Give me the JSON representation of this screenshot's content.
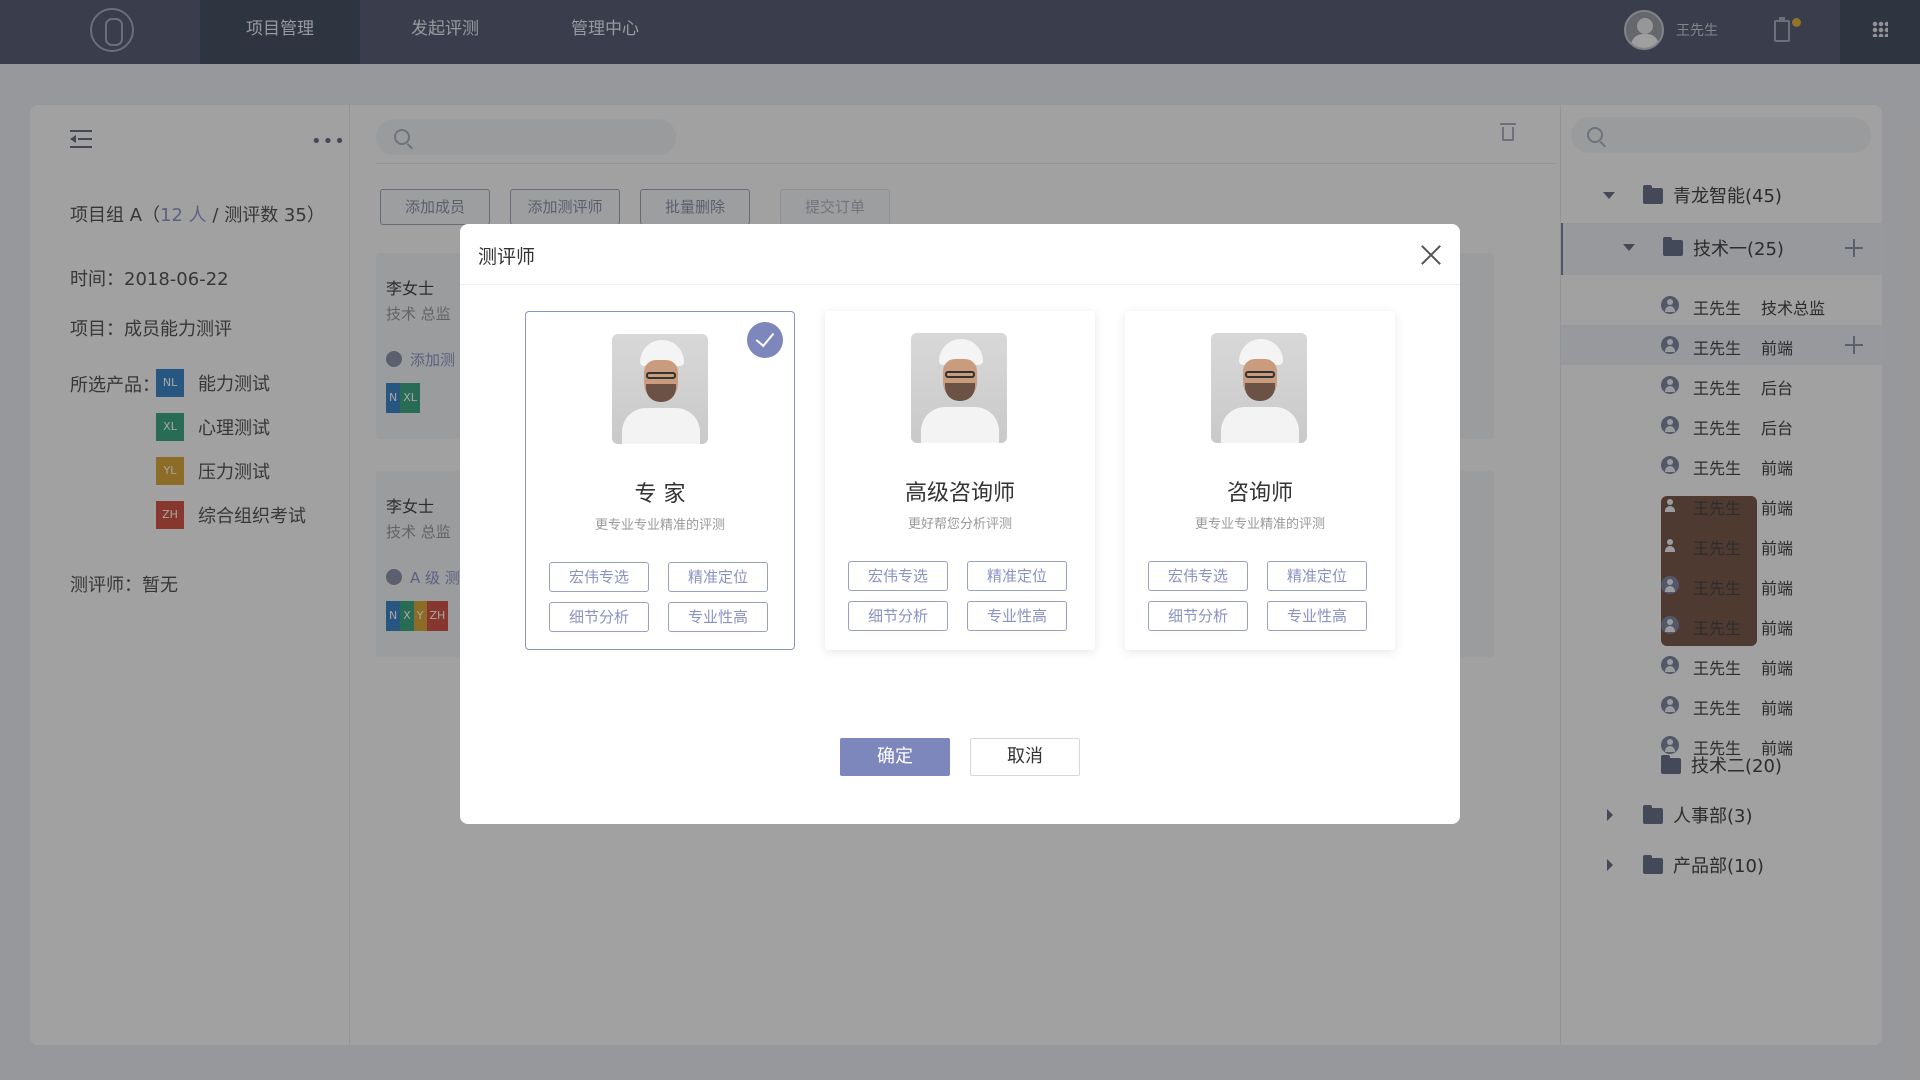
{
  "header": {
    "nav": [
      "项目管理",
      "发起评测",
      "管理中心"
    ],
    "user_name": "王先生"
  },
  "left_panel": {
    "group_prefix": "项目组 A（",
    "group_members": "12 人",
    "group_suffix": " / 测评数 35）",
    "time": "时间：2018-06-22",
    "project": "项目：成员能力测评",
    "products_label": "所选产品：",
    "products": [
      {
        "code": "NL",
        "name": "能力测试",
        "color": "#3d86c6"
      },
      {
        "code": "XL",
        "name": "心理测试",
        "color": "#3ea684"
      },
      {
        "code": "YL",
        "name": "压力测试",
        "color": "#d7a73b"
      },
      {
        "code": "ZH",
        "name": "综合组织考试",
        "color": "#d25548"
      }
    ],
    "evaluator": "测评师：暂无"
  },
  "toolbar": {
    "add_member": "添加成员",
    "add_evaluator": "添加测评师",
    "batch_delete": "批量删除",
    "submit_order": "提交订单"
  },
  "members": [
    {
      "name": "李女士",
      "role": "技术 总监",
      "action": "添加测",
      "chips": [
        "N",
        "XL"
      ]
    },
    {
      "name": "李女士",
      "role": "技术 总监",
      "action": "A 级 测",
      "chips": [
        "N",
        "X",
        "Y",
        "ZH"
      ]
    }
  ],
  "tree": {
    "root": "青龙智能(45)",
    "tech1": "技术一(25)",
    "people": [
      {
        "name": "王先生",
        "role": "技术总监",
        "photo": false
      },
      {
        "name": "王先生",
        "role": "前端",
        "photo": false
      },
      {
        "name": "王先生",
        "role": "后台",
        "photo": false
      },
      {
        "name": "王先生",
        "role": "后台",
        "photo": false
      },
      {
        "name": "王先生",
        "role": "前端",
        "photo": false
      },
      {
        "name": "王先生",
        "role": "前端",
        "photo": true
      },
      {
        "name": "王先生",
        "role": "前端",
        "photo": true
      },
      {
        "name": "王先生",
        "role": "前端",
        "photo": false
      },
      {
        "name": "王先生",
        "role": "前端",
        "photo": false
      },
      {
        "name": "王先生",
        "role": "前端",
        "photo": false
      },
      {
        "name": "王先生",
        "role": "前端",
        "photo": false
      },
      {
        "name": "王先生",
        "role": "前端",
        "photo": false
      }
    ],
    "tech2": "技术二(20)",
    "hr": "人事部(3)",
    "product": "产品部(10)"
  },
  "modal": {
    "title": "测评师",
    "cards": [
      {
        "name": "专 家",
        "desc": "更专业专业精准的评测",
        "selected": true,
        "tags": [
          "宏伟专选",
          "精准定位",
          "细节分析",
          "专业性高"
        ]
      },
      {
        "name": "高级咨询师",
        "desc": "更好帮您分析评测",
        "selected": false,
        "tags": [
          "宏伟专选",
          "精准定位",
          "细节分析",
          "专业性高"
        ]
      },
      {
        "name": "咨询师",
        "desc": "更专业专业精准的评测",
        "selected": false,
        "tags": [
          "宏伟专选",
          "精准定位",
          "细节分析",
          "专业性高"
        ]
      }
    ],
    "ok": "确定",
    "cancel": "取消"
  }
}
